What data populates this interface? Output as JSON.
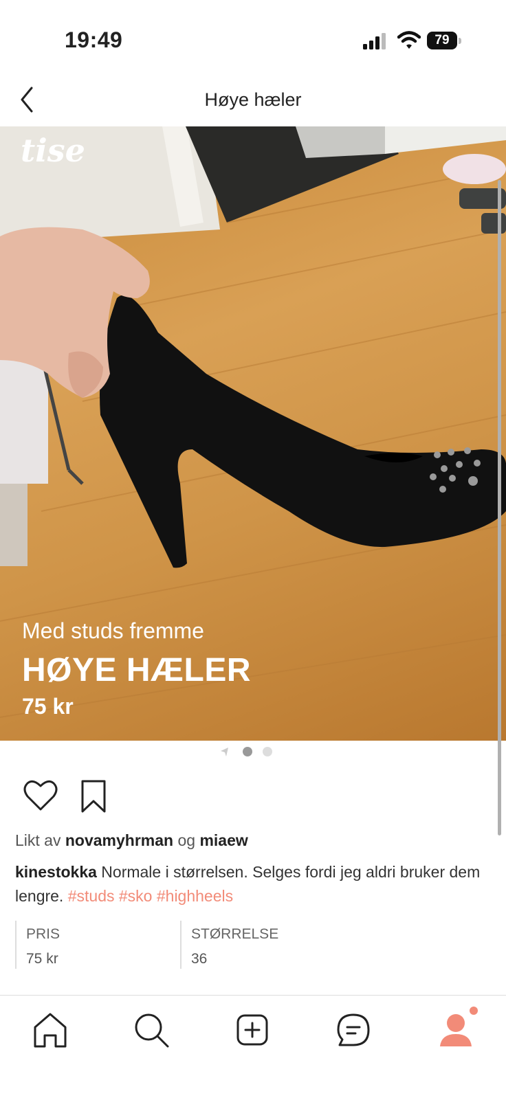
{
  "status": {
    "time": "19:49",
    "battery": "79"
  },
  "nav": {
    "title": "Høye hæler"
  },
  "photo": {
    "logo": "tise",
    "subtitle": "Med studs fremme",
    "title": "HØYE HÆLER",
    "price": "75 kr"
  },
  "likes": {
    "prefix": "Likt av",
    "user1": "novamyhrman",
    "conj": "og",
    "user2": "miaew"
  },
  "description": {
    "user": "kinestokka",
    "text": "Normale i størrelsen. Selges fordi jeg aldri bruker dem lengre.",
    "tags": [
      "#studs",
      "#sko",
      "#highheels"
    ]
  },
  "info": {
    "price_label": "PRIS",
    "price_value": "75 kr",
    "size_label": "STØRRELSE",
    "size_value": "36"
  },
  "colors": {
    "accent": "#f28b78",
    "photo_floor": "#d29a4f",
    "shoe": "#111111"
  },
  "tabs": [
    "home-icon",
    "search-icon",
    "add-icon",
    "chat-icon",
    "profile-icon"
  ]
}
